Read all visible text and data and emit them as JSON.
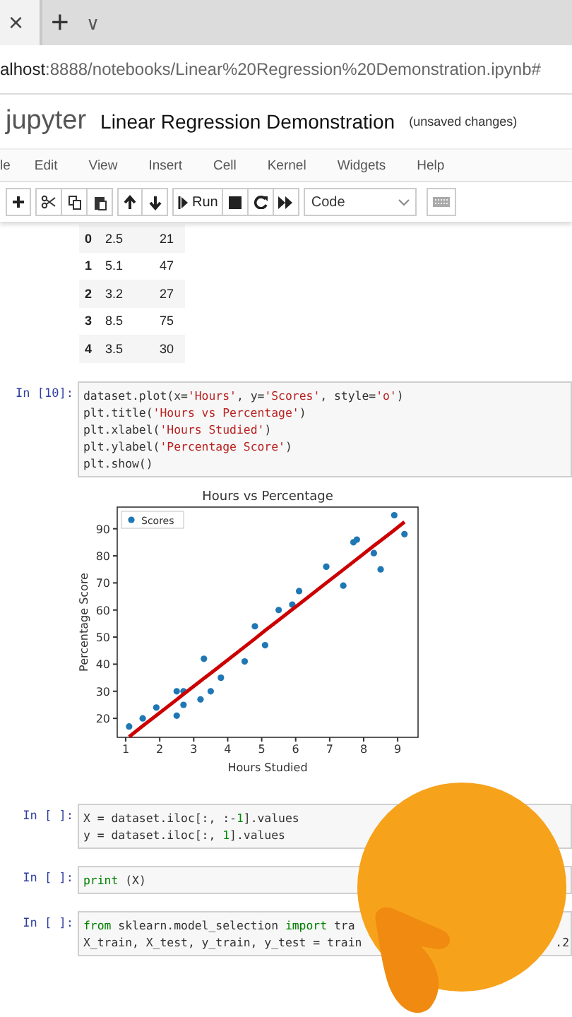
{
  "browser": {
    "tab_close": "×",
    "new_tab": "+",
    "tab_menu": "∨",
    "url_host": "alhost",
    "url_rest": ":8888/notebooks/Linear%20Regression%20Demonstration.ipynb#"
  },
  "header": {
    "logo": "jupyter",
    "title": "Linear Regression Demonstration",
    "status": "(unsaved changes)"
  },
  "menu": [
    "le",
    "Edit",
    "View",
    "Insert",
    "Cell",
    "Kernel",
    "Widgets",
    "Help"
  ],
  "toolbar": {
    "run_label": "Run",
    "cell_type": "Code"
  },
  "table": {
    "rows": [
      [
        "0",
        "2.5",
        "21"
      ],
      [
        "1",
        "5.1",
        "47"
      ],
      [
        "2",
        "3.2",
        "27"
      ],
      [
        "3",
        "8.5",
        "75"
      ],
      [
        "4",
        "3.5",
        "30"
      ]
    ]
  },
  "cells": [
    {
      "prompt": "In [10]:",
      "kind": "plot",
      "lines": [
        [
          {
            "text": "dataset.plot(x=",
            "kind": "plain"
          },
          {
            "text": "'Hours'",
            "kind": "string"
          },
          {
            "text": ", y=",
            "kind": "plain"
          },
          {
            "text": "'Scores'",
            "kind": "string"
          },
          {
            "text": ", style=",
            "kind": "plain"
          },
          {
            "text": "'o'",
            "kind": "string"
          },
          {
            "text": ")",
            "kind": "plain"
          }
        ],
        [
          {
            "text": "plt.title(",
            "kind": "plain"
          },
          {
            "text": "'Hours vs Percentage'",
            "kind": "string"
          },
          {
            "text": ")",
            "kind": "plain"
          }
        ],
        [
          {
            "text": "plt.xlabel(",
            "kind": "plain"
          },
          {
            "text": "'Hours Studied'",
            "kind": "string"
          },
          {
            "text": ")",
            "kind": "plain"
          }
        ],
        [
          {
            "text": "plt.ylabel(",
            "kind": "plain"
          },
          {
            "text": "'Percentage Score'",
            "kind": "string"
          },
          {
            "text": ")",
            "kind": "plain"
          }
        ],
        [
          {
            "text": "plt.show()",
            "kind": "plain"
          }
        ]
      ],
      "chart_data": {
        "type": "scatter",
        "title": "Hours vs Percentage",
        "xlabel": "Hours Studied",
        "ylabel": "Percentage Score",
        "xlim": [
          0.75,
          9.6
        ],
        "ylim": [
          13,
          98
        ],
        "xticks": [
          {
            "value": 1,
            "label": "1"
          },
          {
            "value": 2,
            "label": "2"
          },
          {
            "value": 3,
            "label": "3"
          },
          {
            "value": 4,
            "label": "4"
          },
          {
            "value": 5,
            "label": "5"
          },
          {
            "value": 6,
            "label": "6"
          },
          {
            "value": 7,
            "label": "7"
          },
          {
            "value": 8,
            "label": "8"
          },
          {
            "value": 9,
            "label": "9"
          }
        ],
        "yticks": [
          {
            "value": 20,
            "label": "20"
          },
          {
            "value": 30,
            "label": "30"
          },
          {
            "value": 40,
            "label": "40"
          },
          {
            "value": 50,
            "label": "50"
          },
          {
            "value": 60,
            "label": "60"
          },
          {
            "value": 70,
            "label": "70"
          },
          {
            "value": 80,
            "label": "80"
          },
          {
            "value": 90,
            "label": "90"
          }
        ],
        "x": [
          2.5,
          5.1,
          3.2,
          8.5,
          3.5,
          1.5,
          9.2,
          5.5,
          8.3,
          2.7,
          7.7,
          5.9,
          4.5,
          3.3,
          1.1,
          8.9,
          2.5,
          1.9,
          6.1,
          7.4,
          2.7,
          4.8,
          3.8,
          6.9,
          7.8
        ],
        "series": [
          {
            "name": "Scores",
            "color": "#1f77b4",
            "type": "scatter",
            "values": [
              21,
              47,
              27,
              75,
              30,
              20,
              88,
              60,
              81,
              25,
              85,
              62,
              41,
              42,
              17,
              95,
              30,
              24,
              67,
              69,
              30,
              54,
              35,
              76,
              86
            ]
          },
          {
            "color": "#cc0000",
            "type": "line",
            "values": [
              26.9,
              52.4,
              33.8,
              85.6,
              36.7,
              17.2,
              92.5,
              56.3,
              83.7,
              28.9,
              77.8,
              60.2,
              46.5,
              34.8,
              13.2,
              89.5,
              26.9,
              21.1,
              62.1,
              74.9,
              28.9,
              49.4,
              39.6,
              70.0,
              78.8
            ]
          }
        ]
      }
    },
    {
      "prompt": "In [ ]:",
      "kind": "code",
      "lines": [
        [
          {
            "text": "X = dataset.iloc[:, :-",
            "kind": "plain"
          },
          {
            "text": "1",
            "kind": "number"
          },
          {
            "text": "].values",
            "kind": "plain"
          }
        ],
        [
          {
            "text": "y = dataset.iloc[:, ",
            "kind": "plain"
          },
          {
            "text": "1",
            "kind": "number"
          },
          {
            "text": "].values",
            "kind": "plain"
          }
        ]
      ]
    },
    {
      "prompt": "In [ ]:",
      "kind": "code",
      "lines": [
        [
          {
            "text": "print",
            "kind": "keyword"
          },
          {
            "text": " (X)",
            "kind": "plain"
          }
        ]
      ]
    },
    {
      "prompt": "In [ ]:",
      "kind": "code",
      "lines": [
        [
          {
            "text": "from",
            "kind": "keyword"
          },
          {
            "text": " sklearn.model_selection ",
            "kind": "plain"
          },
          {
            "text": "import",
            "kind": "keyword"
          },
          {
            "text": " tra",
            "kind": "plain"
          }
        ],
        [
          {
            "text": "X_train, X_test, y_train, y_test = train",
            "kind": "plain"
          }
        ]
      ],
      "tail": ".2"
    }
  ],
  "overlay": {
    "kind": "emoji"
  }
}
